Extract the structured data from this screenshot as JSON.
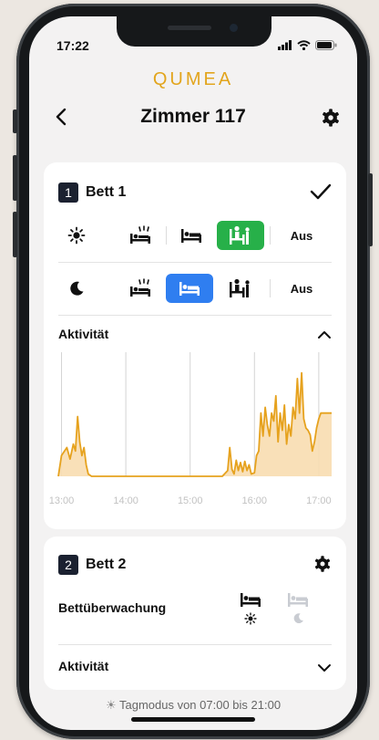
{
  "status": {
    "time": "17:22"
  },
  "header": {
    "logo": "QUMEA",
    "title": "Zimmer 117"
  },
  "bed1": {
    "number": "1",
    "title": "Bett 1",
    "day_row": {
      "mode_icon": "sun-icon",
      "off_label": "Aus",
      "selected": "bed-exit-sitting"
    },
    "night_row": {
      "mode_icon": "moon-icon",
      "off_label": "Aus",
      "selected": "bed-lying"
    },
    "activity_label": "Aktivität"
  },
  "bed2": {
    "number": "2",
    "title": "Bett 2",
    "monitoring_label": "Bettüberwachung",
    "activity_label": "Aktivität"
  },
  "footer": {
    "text": "Tagmodus von 07:00 bis 21:00"
  },
  "colors": {
    "accent_green": "#27b049",
    "accent_blue": "#2f7ef0",
    "chart_line": "#e6a21e",
    "chart_fill": "#f8ddb0",
    "logo": "#e2a51d"
  },
  "chart_data": {
    "type": "area",
    "x_ticks": [
      "13:00",
      "14:00",
      "15:00",
      "16:00",
      "17:00"
    ],
    "xlim": [
      "12:57",
      "17:12"
    ],
    "ylim": [
      0,
      1
    ],
    "grid": "vertical",
    "x": [
      "12:57",
      "13:00",
      "13:05",
      "13:08",
      "13:11",
      "13:13",
      "13:15",
      "13:17",
      "13:19",
      "13:21",
      "13:23",
      "13:25",
      "13:28",
      "14:00",
      "14:30",
      "15:00",
      "15:30",
      "15:35",
      "15:37",
      "15:39",
      "15:41",
      "15:43",
      "15:45",
      "15:47",
      "15:49",
      "15:51",
      "15:53",
      "15:55",
      "15:57",
      "16:00",
      "16:02",
      "16:04",
      "16:06",
      "16:08",
      "16:10",
      "16:12",
      "16:14",
      "16:16",
      "16:18",
      "16:20",
      "16:22",
      "16:24",
      "16:26",
      "16:28",
      "16:30",
      "16:32",
      "16:34",
      "16:36",
      "16:38",
      "16:40",
      "16:42",
      "16:44",
      "16:46",
      "16:48",
      "16:50",
      "16:52",
      "16:54",
      "16:56",
      "16:58",
      "17:00",
      "17:02",
      "17:04",
      "17:06",
      "17:08",
      "17:10",
      "17:12"
    ],
    "y": [
      0.0,
      0.18,
      0.25,
      0.15,
      0.28,
      0.22,
      0.52,
      0.3,
      0.18,
      0.25,
      0.1,
      0.02,
      0.0,
      0.0,
      0.0,
      0.0,
      0.0,
      0.05,
      0.25,
      0.06,
      0.02,
      0.14,
      0.05,
      0.12,
      0.04,
      0.13,
      0.05,
      0.1,
      0.02,
      0.03,
      0.18,
      0.22,
      0.55,
      0.35,
      0.6,
      0.45,
      0.35,
      0.55,
      0.48,
      0.7,
      0.3,
      0.55,
      0.4,
      0.62,
      0.28,
      0.45,
      0.35,
      0.6,
      0.5,
      0.85,
      0.55,
      0.9,
      0.5,
      0.42,
      0.4,
      0.36,
      0.22,
      0.3,
      0.42,
      0.5,
      0.55,
      0.55,
      0.55,
      0.55,
      0.55,
      0.55
    ]
  }
}
